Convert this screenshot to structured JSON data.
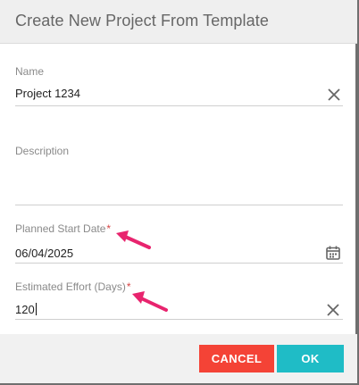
{
  "dialog": {
    "title": "Create New Project From Template",
    "accent_color": "#e8246e"
  },
  "form": {
    "name": {
      "label": "Name",
      "value": "Project 1234"
    },
    "description": {
      "label": "Description",
      "value": ""
    },
    "planned_start_date": {
      "label": "Planned Start Date",
      "required_mark": "*",
      "value": "06/04/2025"
    },
    "estimated_effort": {
      "label": "Estimated Effort (Days)",
      "required_mark": "*",
      "value": "120"
    }
  },
  "actions": {
    "cancel_label": "CANCEL",
    "ok_label": "OK",
    "cancel_color": "#f44336",
    "ok_color": "#1fbcc6"
  },
  "icons": {
    "clear": "close-icon",
    "date": "calendar-icon"
  }
}
